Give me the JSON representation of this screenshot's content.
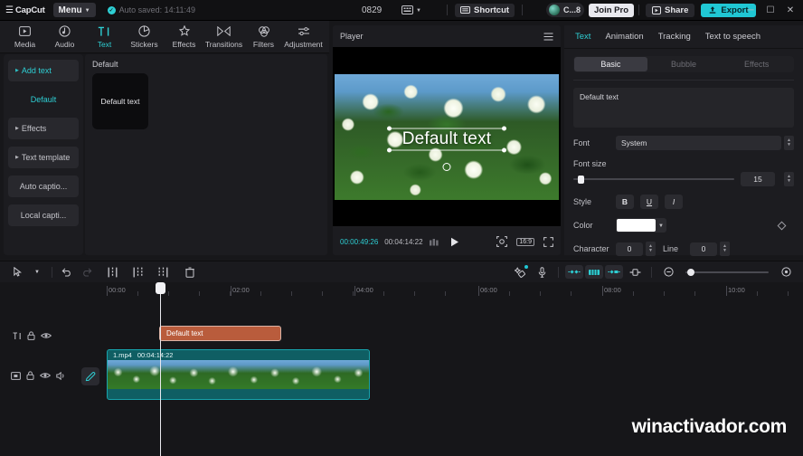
{
  "titlebar": {
    "app_name": "CapCut",
    "menu_label": "Menu",
    "autosave_text": "Auto saved: 14:11:49",
    "project_code": "0829",
    "shortcut_label": "Shortcut",
    "account_name": "C...8",
    "join_pro_label": "Join Pro",
    "share_label": "Share",
    "export_label": "Export",
    "minimize": "─",
    "maximize": "☐",
    "close": "✕",
    "accent_color": "#20c7d4"
  },
  "tooltabs": [
    {
      "label": "Media",
      "icon": "media-icon",
      "active": false
    },
    {
      "label": "Audio",
      "icon": "audio-icon",
      "active": false
    },
    {
      "label": "Text",
      "icon": "text-icon",
      "active": true
    },
    {
      "label": "Stickers",
      "icon": "stickers-icon",
      "active": false
    },
    {
      "label": "Effects",
      "icon": "effects-icon",
      "active": false
    },
    {
      "label": "Transitions",
      "icon": "transitions-icon",
      "active": false
    },
    {
      "label": "Filters",
      "icon": "filters-icon",
      "active": false
    },
    {
      "label": "Adjustment",
      "icon": "adjustment-icon",
      "active": false
    }
  ],
  "sidebar": {
    "items": [
      {
        "label": "Add text",
        "active": true,
        "boxed": true,
        "arrow": true
      },
      {
        "label": "Default",
        "active": true,
        "boxed": false,
        "arrow": false
      },
      {
        "label": "Effects",
        "active": false,
        "boxed": true,
        "arrow": true
      },
      {
        "label": "Text template",
        "active": false,
        "boxed": true,
        "arrow": true
      },
      {
        "label": "Auto captio...",
        "active": false,
        "boxed": true,
        "arrow": false
      },
      {
        "label": "Local capti...",
        "active": false,
        "boxed": true,
        "arrow": false
      }
    ]
  },
  "presets": {
    "group_label": "Default",
    "card_label": "Default text"
  },
  "player": {
    "title": "Player",
    "menu_icon": "hamburger-icon",
    "overlay_text": "Default text",
    "current_time": "00:00:49:26",
    "total_time": "00:04:14:22",
    "quality_icon": "quality-icon",
    "play_icon": "play-icon",
    "crop_icon": "crop-icon",
    "ratio_label": "16:9",
    "fullscreen_icon": "fullscreen-icon"
  },
  "right_panel": {
    "tabs": [
      {
        "label": "Text",
        "active": true
      },
      {
        "label": "Animation",
        "active": false
      },
      {
        "label": "Tracking",
        "active": false
      },
      {
        "label": "Text to speech",
        "active": false
      }
    ],
    "segments": [
      {
        "label": "Basic",
        "active": true
      },
      {
        "label": "Bubble",
        "active": false
      },
      {
        "label": "Effects",
        "active": false
      }
    ],
    "text_value": "Default text",
    "font_label": "Font",
    "font_value": "System",
    "font_size_label": "Font size",
    "font_size_value": "15",
    "style_label": "Style",
    "style_buttons": [
      {
        "label": "B",
        "name": "bold-button"
      },
      {
        "label": "U",
        "name": "underline-button"
      },
      {
        "label": "I",
        "name": "italic-button"
      }
    ],
    "color_label": "Color",
    "color_value": "#ffffff",
    "character_label": "Character",
    "character_value": "0",
    "line_label": "Line",
    "line_value": "0"
  },
  "timeline_toolbar": {
    "select_icon": "cursor-icon",
    "dropdown_icon": "chevron-down-icon",
    "undo_icon": "undo-icon",
    "redo_icon": "redo-icon",
    "split_icon": "split-icon",
    "trim_left_icon": "trim-left-icon",
    "trim_right_icon": "trim-right-icon",
    "delete_icon": "delete-icon",
    "magic_icon": "magic-wand-icon",
    "mic_icon": "microphone-icon",
    "keyframe_icon": "keyframe-icon",
    "mixer_icon": "mixer-icon",
    "marker_icon": "marker-icon",
    "crop_icon": "crop-icon",
    "zoom_out_icon": "zoom-out-icon",
    "fit_icon": "fit-to-screen-icon"
  },
  "timeline": {
    "ruler_labels": [
      "00:00",
      "02:00",
      "04:00",
      "06:00",
      "08:00",
      "10:00"
    ],
    "tracks": [
      {
        "name": "text-track",
        "icons": [
          "text-icon",
          "lock-icon",
          "eye-icon"
        ],
        "clip": {
          "label": "Default text",
          "type": "text"
        }
      },
      {
        "name": "video-track",
        "icons": [
          "video-icon",
          "lock-icon",
          "eye-icon",
          "speaker-icon"
        ],
        "clip": {
          "label": "1.mp4",
          "duration": "00:04:14:22",
          "type": "video"
        }
      }
    ]
  },
  "watermark": "winactivador.com"
}
